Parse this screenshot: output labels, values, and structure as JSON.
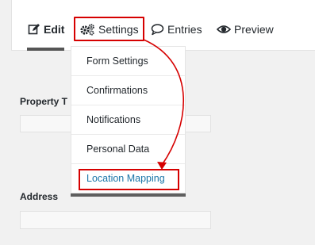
{
  "tabs": {
    "edit": "Edit",
    "settings": "Settings",
    "entries": "Entries",
    "preview": "Preview"
  },
  "form": {
    "property_label": "Property T",
    "address_label": "Address"
  },
  "settings_menu": {
    "items": [
      "Form Settings",
      "Confirmations",
      "Notifications",
      "Personal Data",
      "Location Mapping"
    ],
    "selected": "Location Mapping"
  },
  "colors": {
    "highlight": "#d60000",
    "link": "#1a75a8",
    "text": "#23282d"
  },
  "icons": {
    "edit": "edit-icon",
    "settings": "gears-icon",
    "entries": "speech-bubble-icon",
    "preview": "eye-icon"
  }
}
